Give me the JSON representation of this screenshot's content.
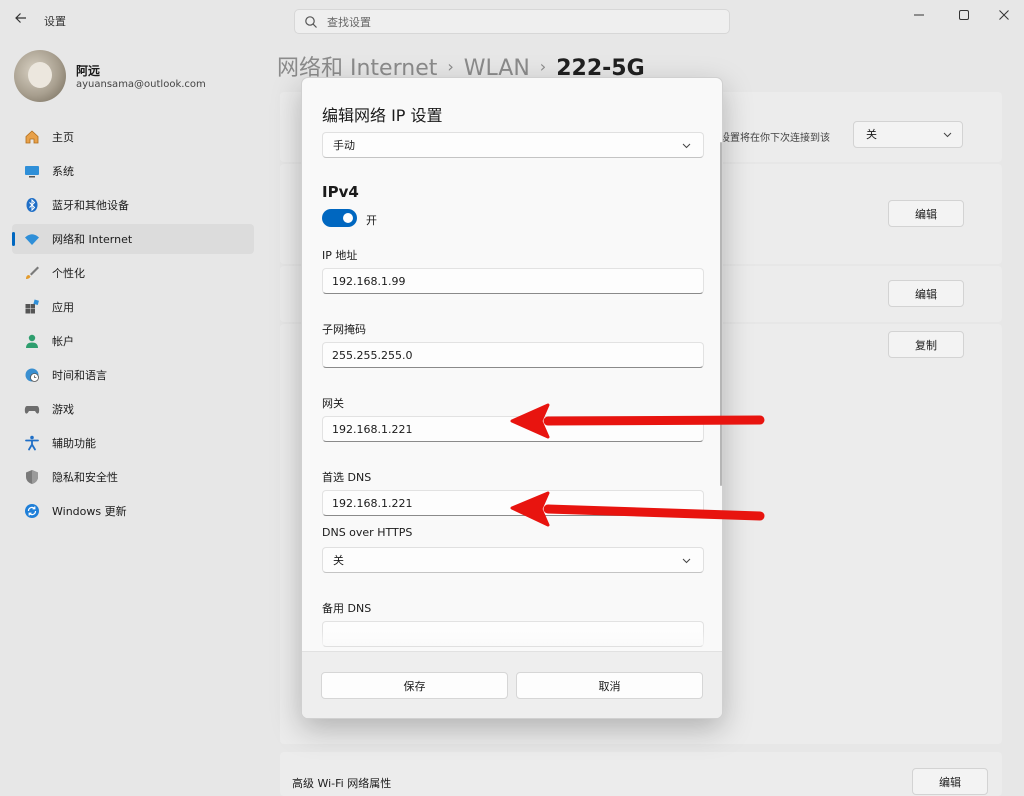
{
  "window": {
    "title": "设置",
    "search_placeholder": "查找设置"
  },
  "user": {
    "name": "阿远",
    "email": "ayuansama@outlook.com"
  },
  "sidebar": {
    "items": [
      {
        "label": "主页",
        "icon": "home-icon"
      },
      {
        "label": "系统",
        "icon": "monitor-icon"
      },
      {
        "label": "蓝牙和其他设备",
        "icon": "bluetooth-icon"
      },
      {
        "label": "网络和 Internet",
        "icon": "wifi-icon",
        "active": true
      },
      {
        "label": "个性化",
        "icon": "brush-icon"
      },
      {
        "label": "应用",
        "icon": "apps-icon"
      },
      {
        "label": "帐户",
        "icon": "person-icon"
      },
      {
        "label": "时间和语言",
        "icon": "globe-clock-icon"
      },
      {
        "label": "游戏",
        "icon": "gamepad-icon"
      },
      {
        "label": "辅助功能",
        "icon": "accessibility-icon"
      },
      {
        "label": "隐私和安全性",
        "icon": "shield-icon"
      },
      {
        "label": "Windows 更新",
        "icon": "update-icon"
      }
    ]
  },
  "breadcrumb": {
    "part1": "网络和 Internet",
    "part2": "WLAN",
    "current": "222-5G"
  },
  "background": {
    "row1_text": "设置将在你下次连接到该",
    "row1_select": "关",
    "edit_label": "编辑",
    "copy_label": "复制",
    "advanced_label": "高级 Wi-Fi 网络属性"
  },
  "dialog": {
    "title": "编辑网络 IP 设置",
    "mode": "手动",
    "section": "IPv4",
    "toggle_label": "开",
    "ip_label": "IP 地址",
    "ip_value": "192.168.1.99",
    "subnet_label": "子网掩码",
    "subnet_value": "255.255.255.0",
    "gateway_label": "网关",
    "gateway_value": "192.168.1.221",
    "dns_label": "首选 DNS",
    "dns_value": "192.168.1.221",
    "doh_label": "DNS over HTTPS",
    "doh_value": "关",
    "alt_dns_label": "备用 DNS",
    "save": "保存",
    "cancel": "取消"
  },
  "colors": {
    "accent": "#0067c0",
    "arrow": "#e8140f"
  }
}
